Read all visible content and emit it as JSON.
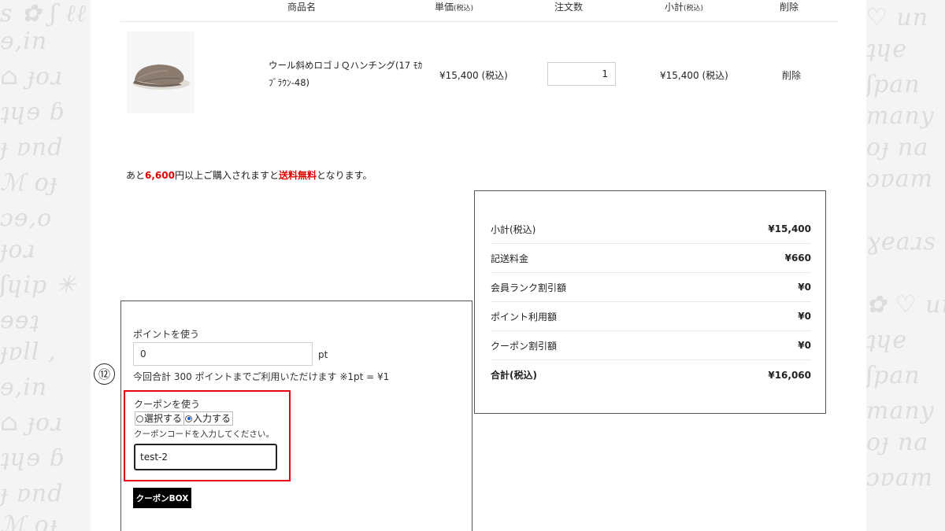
{
  "table_header": {
    "product_name": "商品名",
    "unit_price": "単価",
    "unit_price_note": "(税込)",
    "quantity": "注文数",
    "subtotal": "小計",
    "subtotal_note": "(税込)",
    "delete": "削除"
  },
  "item": {
    "name_line1": "ウール斜めロゴＪＱハンチング(17 ﾓｶ",
    "name_line2": "ﾌﾞﾗｳﾝ-48)",
    "unit_price": "¥15,400 (税込)",
    "quantity": "1",
    "subtotal": "¥15,400 (税込)",
    "delete_label": "削除"
  },
  "shipping_note": {
    "prefix": "あと",
    "amount": "6,600",
    "middle": "円以上ご購入されますと",
    "highlight": "送料無料",
    "suffix": "となります。"
  },
  "summary": {
    "rows": [
      {
        "label": "小計(税込)",
        "value": "¥15,400"
      },
      {
        "label": "記送料金",
        "value": "¥660"
      },
      {
        "label": "会員ランク割引額",
        "value": "¥0"
      },
      {
        "label": "ポイント利用額",
        "value": "¥0"
      },
      {
        "label": "クーポン割引額",
        "value": "¥0"
      },
      {
        "label": "合計(税込)",
        "value": "¥16,060"
      }
    ]
  },
  "points": {
    "title": "ポイントを使う",
    "value": "0",
    "unit": "pt",
    "note": "今回合計 300 ポイントまでご利用いただけます ※1pt = ¥1"
  },
  "coupon": {
    "title": "クーポンを使う",
    "option_select": "選択する",
    "option_input": "入力する",
    "selected": "input",
    "instruction": "クーポンコードを入力してください。",
    "code": "test-2",
    "box_button": "クーポンBOX"
  },
  "step_marker": "⑫"
}
